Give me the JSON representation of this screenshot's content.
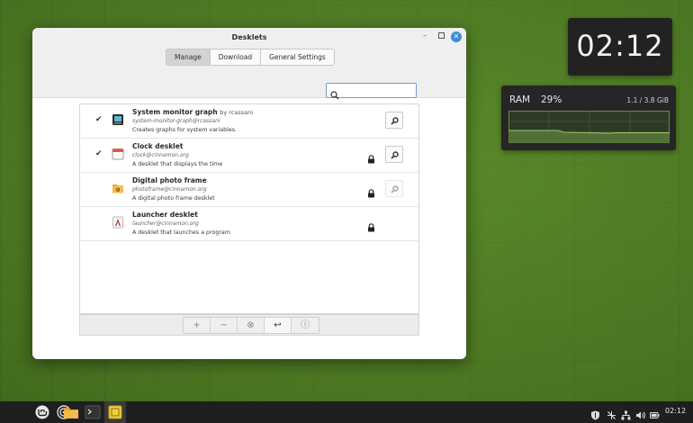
{
  "window": {
    "title": "Desklets",
    "tabs": [
      {
        "label": "Manage",
        "active": true
      },
      {
        "label": "Download",
        "active": false
      },
      {
        "label": "General Settings",
        "active": false
      }
    ],
    "search": {
      "value": "",
      "placeholder": ""
    }
  },
  "desklets": [
    {
      "name": "System monitor graph",
      "author": "by rcassani",
      "uuid": "system-monitor-graph@rcassani",
      "description": "Creates graphs for system variables.",
      "enabled": true,
      "locked": false,
      "icon": "monitor-icon",
      "configurable": true
    },
    {
      "name": "Clock desklet",
      "author": "",
      "uuid": "clock@cinnamon.org",
      "description": "A desklet that displays the time",
      "enabled": true,
      "locked": true,
      "icon": "calendar-icon",
      "configurable": true
    },
    {
      "name": "Digital photo frame",
      "author": "",
      "uuid": "photoframe@cinnamon.org",
      "description": "A digital photo frame desklet",
      "enabled": false,
      "locked": true,
      "icon": "folder-photo-icon",
      "configurable": false
    },
    {
      "name": "Launcher desklet",
      "author": "",
      "uuid": "launcher@cinnamon.org",
      "description": "A desklet that launches a program",
      "enabled": false,
      "locked": true,
      "icon": "launcher-icon",
      "configurable": null
    }
  ],
  "toolbar": {
    "add_label": "+",
    "remove_label": "−",
    "clear_label": "⊗",
    "undo_label": "↩",
    "info_label": "ⓘ"
  },
  "clock_desklet": {
    "time": "02:12"
  },
  "ram_desklet": {
    "label": "RAM",
    "percent": "29%",
    "usage": "1.1 / 3.8 GiB"
  },
  "taskbar": {
    "clock": "02:12",
    "pinned": [
      "mint-menu-icon",
      "target-icon",
      "files-icon",
      "terminal-icon",
      "notes-icon"
    ],
    "tray": [
      "shield-icon",
      "network-off-icon",
      "network-icon",
      "volume-icon",
      "battery-icon"
    ]
  },
  "colors": {
    "accent": "#3d8ed8",
    "desktop": "#4f7a24",
    "graph_line": "#9bc86a"
  }
}
